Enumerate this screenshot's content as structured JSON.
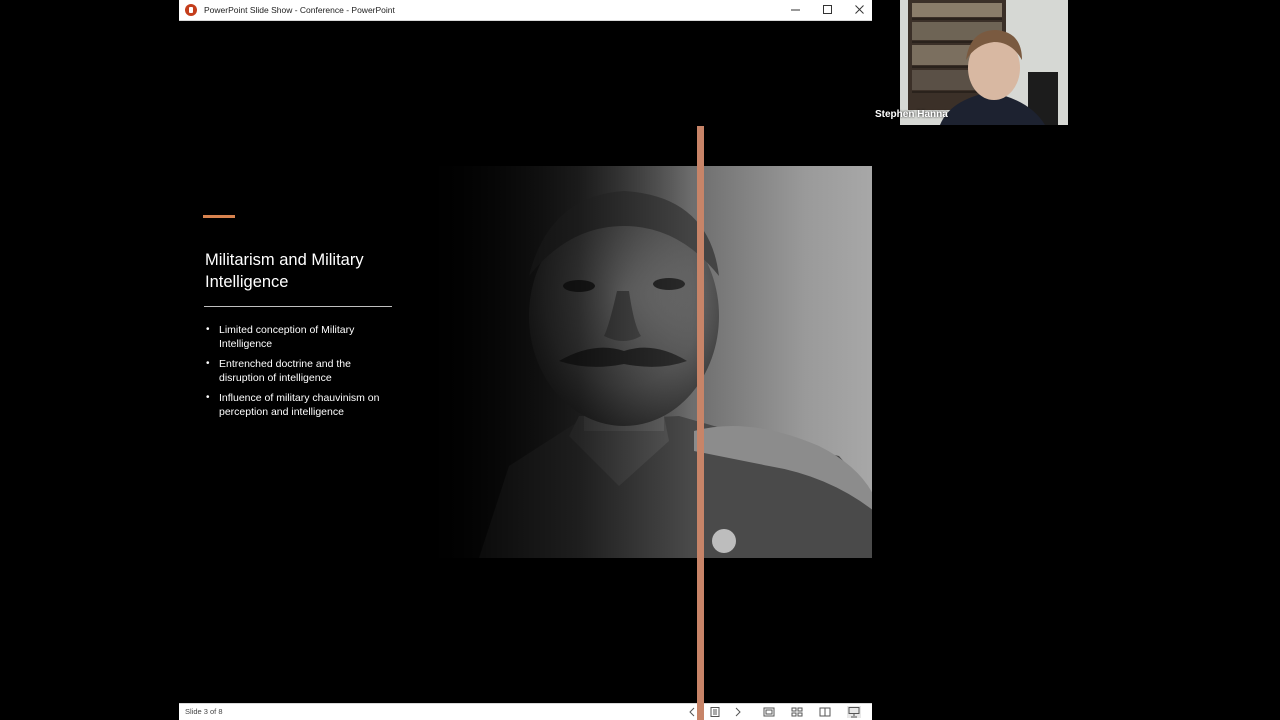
{
  "window": {
    "title": "PowerPoint Slide Show  -  Conference - PowerPoint",
    "app_icon": "powerpoint-icon",
    "controls": [
      "minimize-icon",
      "maximize-icon",
      "close-icon"
    ]
  },
  "slide": {
    "title": "Militarism and Military Intelligence",
    "bullets": [
      "Limited conception of Military Intelligence",
      "Entrenched doctrine and the disruption of intelligence",
      "Influence of military chauvinism on perception and intelligence"
    ],
    "accent_color": "#d7834f",
    "photo": "black-and-white-portrait-photo"
  },
  "statusbar": {
    "slide_counter": "Slide 3 of 8",
    "icons": [
      "prev-slide-icon",
      "slide-list-icon",
      "next-slide-icon",
      "normal-view-icon",
      "slide-sorter-icon",
      "reading-view-icon",
      "slideshow-icon"
    ]
  },
  "webcam": {
    "participant_name": "Stephen Hanna"
  }
}
